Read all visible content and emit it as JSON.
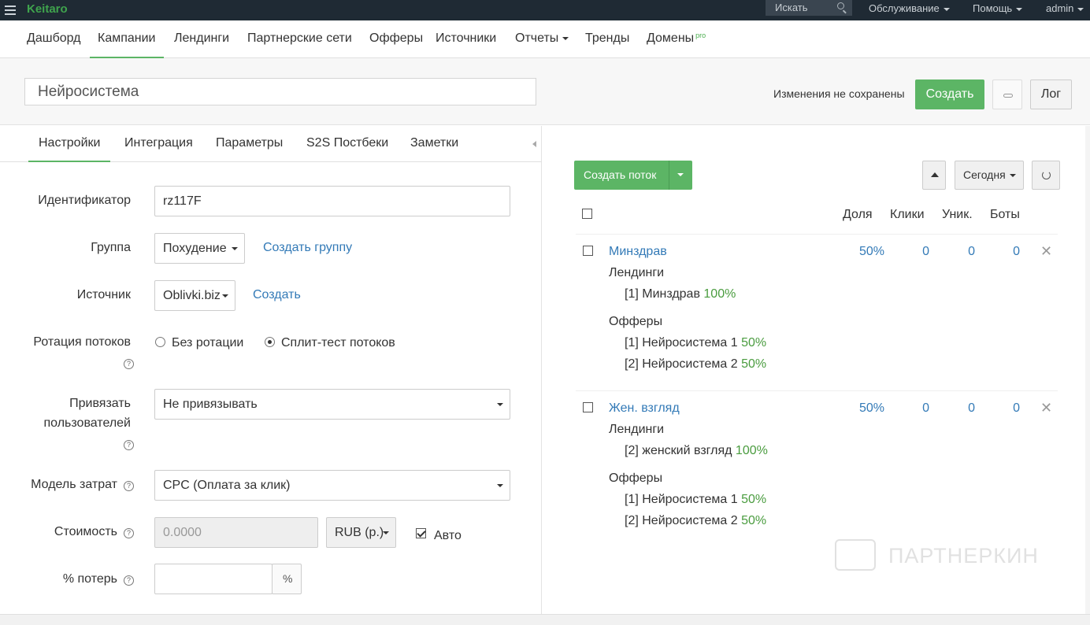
{
  "topbar": {
    "logo": "Keitaro",
    "search_placeholder": "Искать",
    "menu": [
      "Обслуживание",
      "Помощь",
      "admin"
    ]
  },
  "nav": {
    "items": [
      "Дашборд",
      "Кампании",
      "Лендинги",
      "Партнерские сети",
      "Офферы",
      "Источники",
      "Отчеты",
      "Тренды",
      "Домены"
    ],
    "active": "Кампании",
    "domains_badge": "pro"
  },
  "header": {
    "campaign_name": "Нейросистема",
    "unsaved_text": "Изменения не сохранены",
    "create_label": "Создать",
    "log_label": "Лог"
  },
  "tabs": [
    "Настройки",
    "Интеграция",
    "Параметры",
    "S2S Постбеки",
    "Заметки"
  ],
  "form": {
    "id_label": "Идентификатор",
    "id_value": "rz117F",
    "group_label": "Группа",
    "group_value": "Похудение",
    "create_group_link": "Создать группу",
    "source_label": "Источник",
    "source_value": "Oblivki.biz",
    "create_source_link": "Создать",
    "rotation_label": "Ротация потоков",
    "rotation_opt1": "Без ротации",
    "rotation_opt2": "Сплит-тест потоков",
    "bind_label_1": "Привязать",
    "bind_label_2": "пользователей",
    "bind_value": "Не привязывать",
    "cost_model_label": "Модель затрат",
    "cost_model_value": "CPC (Оплата за клик)",
    "cost_label": "Стоимость",
    "cost_placeholder": "0.0000",
    "currency_value": "RUB (р.)",
    "auto_label": "Авто",
    "loss_label": "% потерь",
    "loss_suffix": "%",
    "help": "?"
  },
  "flows_panel": {
    "create_flow_label": "Создать поток",
    "today_label": "Сегодня",
    "columns": [
      "Доля",
      "Клики",
      "Уник.",
      "Боты"
    ],
    "flows": [
      {
        "name": "Минздрав",
        "share": "50%",
        "clicks": "0",
        "uniques": "0",
        "bots": "0",
        "landings_title": "Лендинги",
        "landings": [
          {
            "name": "[1] Минздрав",
            "pct": "100%"
          }
        ],
        "offers_title": "Офферы",
        "offers": [
          {
            "name": "[1] Нейросистема 1",
            "pct": "50%"
          },
          {
            "name": "[2] Нейросистема 2",
            "pct": "50%"
          }
        ]
      },
      {
        "name": "Жен. взгляд",
        "share": "50%",
        "clicks": "0",
        "uniques": "0",
        "bots": "0",
        "landings_title": "Лендинги",
        "landings": [
          {
            "name": "[2] женский взгляд",
            "pct": "100%"
          }
        ],
        "offers_title": "Офферы",
        "offers": [
          {
            "name": "[1] Нейросистема 1",
            "pct": "50%"
          },
          {
            "name": "[2] Нейросистема 2",
            "pct": "50%"
          }
        ]
      }
    ]
  },
  "watermark": "ПАРТНЕРКИН",
  "colors": {
    "accent": "#5cb565",
    "link": "#337ab7",
    "topbar": "#1f2a34"
  }
}
